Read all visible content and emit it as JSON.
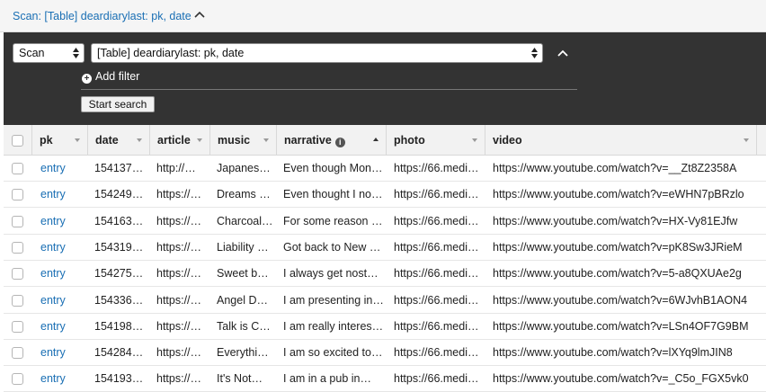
{
  "header": {
    "title": "Scan: [Table] deardiarylast: pk, date"
  },
  "search": {
    "mode_select": "Scan",
    "table_select": "[Table] deardiarylast: pk, date",
    "add_filter": "Add filter",
    "start_search": "Start search"
  },
  "grid": {
    "columns": [
      {
        "label": "pk"
      },
      {
        "label": "date"
      },
      {
        "label": "article"
      },
      {
        "label": "music"
      },
      {
        "label": "narrative"
      },
      {
        "label": "photo"
      },
      {
        "label": "video"
      }
    ],
    "rows": [
      [
        "entry",
        "154137…",
        "http://…",
        "Japanes…",
        "Even though Mon…",
        "https://66.medi…",
        "https://www.youtube.com/watch?v=__Zt8Z2358A"
      ],
      [
        "entry",
        "154249…",
        "https://…",
        "Dreams …",
        "Even thought I nor…",
        "https://66.medi…",
        "https://www.youtube.com/watch?v=eWHN7pBRzlo"
      ],
      [
        "entry",
        "154163…",
        "https://…",
        "Charcoal…",
        "For some reason …",
        "https://66.medi…",
        "https://www.youtube.com/watch?v=HX-Vy81EJfw"
      ],
      [
        "entry",
        "154319…",
        "https://…",
        "Liability …",
        "Got back to New …",
        "https://66.medi…",
        "https://www.youtube.com/watch?v=pK8Sw3JRieM"
      ],
      [
        "entry",
        "154275…",
        "https://…",
        "Sweet b…",
        "I always get nostal…",
        "https://66.medi…",
        "https://www.youtube.com/watch?v=5-a8QXUAe2g"
      ],
      [
        "entry",
        "154336…",
        "https://…",
        "Angel D…",
        "I am presenting in …",
        "https://66.medi…",
        "https://www.youtube.com/watch?v=6WJvhB1AON4"
      ],
      [
        "entry",
        "154198…",
        "https://…",
        "Talk is C…",
        "I am really interest…",
        "https://66.medi…",
        "https://www.youtube.com/watch?v=LSn4OF7G9BM"
      ],
      [
        "entry",
        "154284…",
        "https://…",
        "Everythi…",
        "I am so excited to …",
        "https://66.medi…",
        "https://www.youtube.com/watch?v=lXYq9lmJIN8"
      ],
      [
        "entry",
        "154193…",
        "https://…",
        "It's Not…",
        "I am in a pub in…",
        "https://66.medi…",
        "https://www.youtube.com/watch?v=_C5o_FGX5vk0"
      ]
    ]
  },
  "colors": {
    "link": "#1a6fb4",
    "panel": "#333333"
  }
}
